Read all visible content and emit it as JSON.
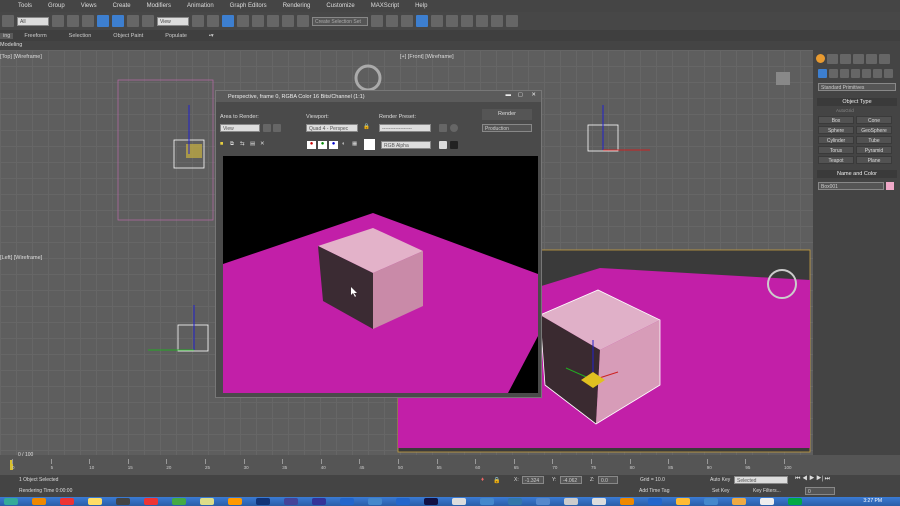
{
  "menu": [
    "Tools",
    "Group",
    "Views",
    "Create",
    "Modifiers",
    "Animation",
    "Graph Editors",
    "Rendering",
    "Customize",
    "MAXScript",
    "Help"
  ],
  "toolbar": {
    "selection_filter": "All",
    "ref_coord": "View",
    "named_sel": "Create Selection Set"
  },
  "ribbon": {
    "tabs": [
      "ing",
      "Freeform",
      "Selection",
      "Object Paint",
      "Populate"
    ],
    "sub": "Modeling"
  },
  "viewports": {
    "top": "[Top] [Wireframe]",
    "front": "[+] [Front] [Wireframe]",
    "left": "[Left] [Wireframe]"
  },
  "render_window": {
    "title": "Perspective, frame 0, RGBA Color 16 Bits/Channel (1:1)",
    "area_label": "Area to Render:",
    "area_value": "View",
    "viewport_label": "Viewport:",
    "viewport_value": "Quad 4 - Perspec",
    "preset_label": "Render Preset:",
    "preset_value": "------------------",
    "render_button": "Render",
    "render_mode": "Production",
    "channel": "RGB Alpha"
  },
  "command_panel": {
    "category": "Standard Primitives",
    "object_type": "Object Type",
    "autogrid": "AutoGrid",
    "buttons": [
      "Box",
      "Cone",
      "Sphere",
      "GeoSphere",
      "Cylinder",
      "Tube",
      "Torus",
      "Pyramid",
      "Teapot",
      "Plane"
    ],
    "name_color": "Name and Color",
    "object_name": "Box001",
    "object_color": "#f0a8c8"
  },
  "timeline": {
    "frame": "0 / 100",
    "ticks": [
      "0",
      "5",
      "10",
      "15",
      "20",
      "25",
      "30",
      "35",
      "40",
      "45",
      "50",
      "55",
      "60",
      "65",
      "70",
      "75",
      "80",
      "85",
      "90",
      "95",
      "100"
    ]
  },
  "status": {
    "selected": "1 Object Selected",
    "render_time": "Rendering Time  0:00:00",
    "x": "-1.324",
    "y": "-4.062",
    "z": "0.0",
    "grid": "Grid = 10.0",
    "add_time_tag": "Add Time Tag",
    "auto_key": "Auto Key",
    "key_mode": "Selected",
    "set_key": "Set Key",
    "key_filters": "Key Filters...",
    "frame_field": "0"
  },
  "taskbar": {
    "clock": "3:27 PM"
  }
}
